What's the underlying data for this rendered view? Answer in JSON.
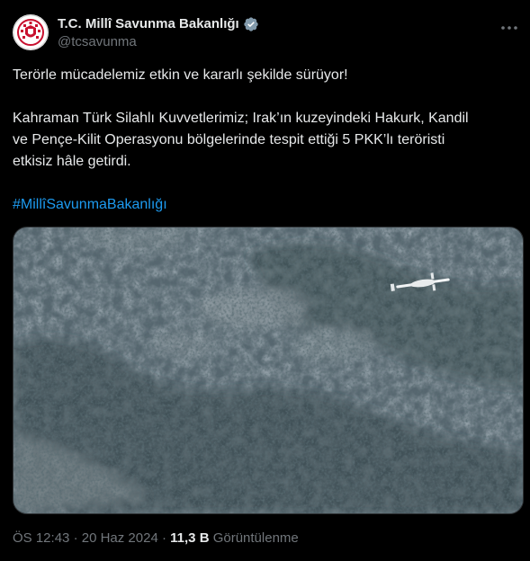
{
  "author": {
    "display_name": "T.C. Millî Savunma Bakanlığı",
    "handle": "@tcsavunma",
    "verified": true,
    "avatar_icon": "ministry-emblem-icon"
  },
  "more_icon": "more-options-icon",
  "post": {
    "line1": "Terörle mücadelemiz etkin ve kararlı şekilde sürüyor!",
    "line2": "Kahraman Türk Silahlı Kuvvetlerimiz; Irak’ın kuzeyindeki Hakurk, Kandil",
    "line3": "ve Pençe-Kilit Operasyonu bölgelerinde tespit ettiği 5 PKK’lı teröristi",
    "line4": "etkisiz hâle getirdi.",
    "hashtag": "#MillîSavunmaBakanlığı"
  },
  "meta": {
    "time": "ÖS 12:43",
    "separator": "·",
    "date": "20 Haz 2024",
    "views_count": "11,3 B",
    "views_label": "Görüntülenme"
  },
  "colors": {
    "background": "#000000",
    "text": "#e7e9ea",
    "secondary": "#71767b",
    "link": "#1d9bf0",
    "verified": "#829aab"
  }
}
